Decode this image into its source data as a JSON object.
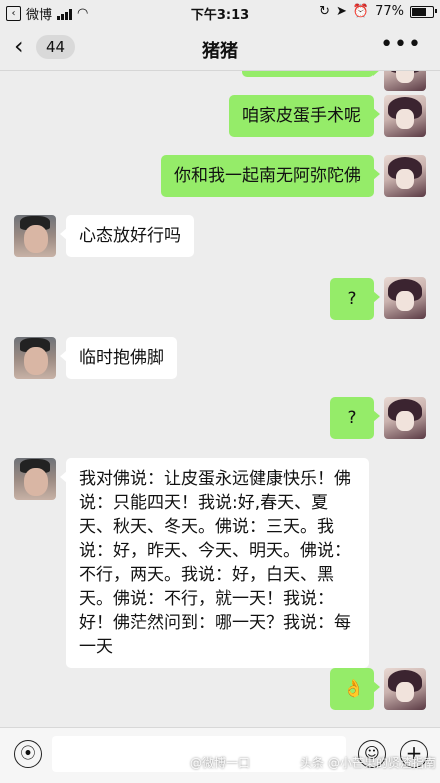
{
  "status_bar": {
    "carrier": "微博",
    "time": "下午3:13",
    "battery_text": "77%",
    "battery_level": 0.77
  },
  "nav": {
    "unread_count": "44",
    "title": "猪猪"
  },
  "messages": [
    {
      "side": "out",
      "text": "咱家皮蛋手术呢"
    },
    {
      "side": "out",
      "text": "你和我一起南无阿弥陀佛"
    },
    {
      "side": "in",
      "text": "心态放好行吗"
    },
    {
      "side": "out",
      "text": "?"
    },
    {
      "side": "in",
      "text": "临时抱佛脚"
    },
    {
      "side": "out",
      "text": "?"
    },
    {
      "side": "in",
      "lines": [
        "我对佛说：让皮蛋永远健康快乐！佛",
        "说：只能四天！我说:好,春天、夏",
        "天、秋天、冬天。佛说：三天。我",
        "说：好，昨天、今天、明天。佛说：",
        "不行，两天。我说：好，白天、黑",
        "天。佛说：不行，就一天！我说：",
        "好！佛茫然问到：哪一天？我说：每",
        "一天"
      ]
    },
    {
      "side": "out",
      "text": "👌"
    }
  ],
  "watermarks": {
    "left": "@微博一口",
    "right": "头条 @小芒果的贤渣指南"
  },
  "icons": {
    "voice": "voice-icon",
    "emoji": "emoji-icon",
    "add": "plus-icon"
  }
}
